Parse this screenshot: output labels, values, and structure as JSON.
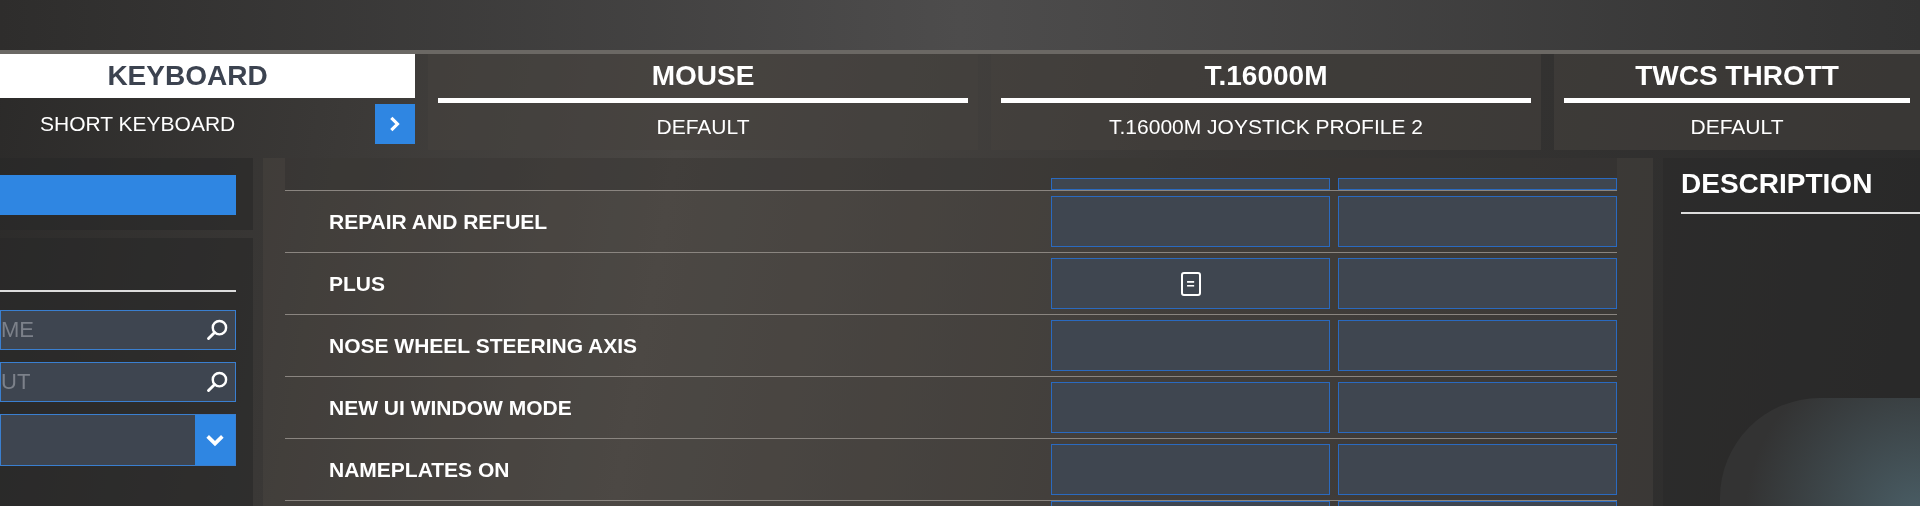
{
  "device_tabs": [
    {
      "title": "KEYBOARD",
      "profile": "SHORT KEYBOARD",
      "selected": true
    },
    {
      "title": "MOUSE",
      "profile": "DEFAULT",
      "selected": false
    },
    {
      "title": "T.16000M",
      "profile": "T.16000M JOYSTICK PROFILE 2",
      "selected": false
    },
    {
      "title": "TWCS THROTT",
      "profile": "DEFAULT",
      "selected": false
    }
  ],
  "filters": [
    {
      "kind": "search",
      "placeholder": "ME"
    },
    {
      "kind": "search",
      "placeholder": "UT"
    },
    {
      "kind": "dropdown"
    }
  ],
  "bindings": [
    {
      "kind": "partial"
    },
    {
      "kind": "row",
      "label": "REPAIR AND REFUEL"
    },
    {
      "kind": "row",
      "label": "PLUS",
      "primary_key": "="
    },
    {
      "kind": "row",
      "label": "NOSE WHEEL STEERING AXIS"
    },
    {
      "kind": "row",
      "label": "NEW UI WINDOW MODE"
    },
    {
      "kind": "row",
      "label": "NAMEPLATES ON"
    },
    {
      "kind": "partial"
    }
  ],
  "description": {
    "title": "DESCRIPTION"
  }
}
